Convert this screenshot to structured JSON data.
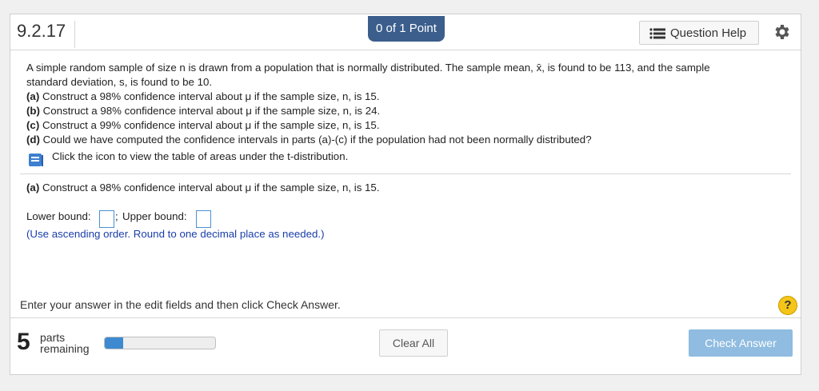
{
  "header": {
    "question_number": "9.2.17",
    "points": "0 of 1 Point",
    "question_help": "Question Help",
    "help_icon": "list-icon",
    "settings_icon": "gear-icon"
  },
  "problem": {
    "intro_1": "A simple random sample of size n is drawn from a population that is normally distributed. The sample mean, x̄, is found to be 113, and the sample",
    "intro_2": "standard deviation, s, is found to be 10.",
    "parts": [
      {
        "tag": "(a)",
        "text": " Construct a 98% confidence interval about μ if the sample size, n, is 15."
      },
      {
        "tag": "(b)",
        "text": " Construct a 98% confidence interval about μ if the sample size, n, is 24."
      },
      {
        "tag": "(c)",
        "text": " Construct a 99% confidence interval about μ if the sample size, n, is 15."
      },
      {
        "tag": "(d)",
        "text": " Could we have computed the confidence intervals in parts (a)-(c) if the population had not been normally distributed?"
      }
    ],
    "table_link": "Click the icon to view the table of areas under the t-distribution.",
    "book_icon": "book-icon"
  },
  "current_part": {
    "tag": "(a)",
    "text": " Construct a 98% confidence interval about μ if the sample size, n, is 15.",
    "lower_label": "Lower bound:",
    "separator": ";",
    "upper_label": "Upper bound:",
    "lower_value": "",
    "upper_value": "",
    "hint": "(Use ascending order. Round to one decimal place as needed.)"
  },
  "footer": {
    "instruction": "Enter your answer in the edit fields and then click Check Answer.",
    "help_symbol": "?",
    "parts_count": "5",
    "parts_label_1": "parts",
    "parts_label_2": "remaining",
    "progress_fraction": 0.17,
    "clear_all": "Clear All",
    "check_answer": "Check Answer"
  },
  "colors": {
    "points_badge": "#3b5e8c",
    "progress_fill": "#3d8ad0",
    "check_button": "#8fbce0",
    "hint_text": "#1a3ea8",
    "help_circle": "#f5c518"
  }
}
